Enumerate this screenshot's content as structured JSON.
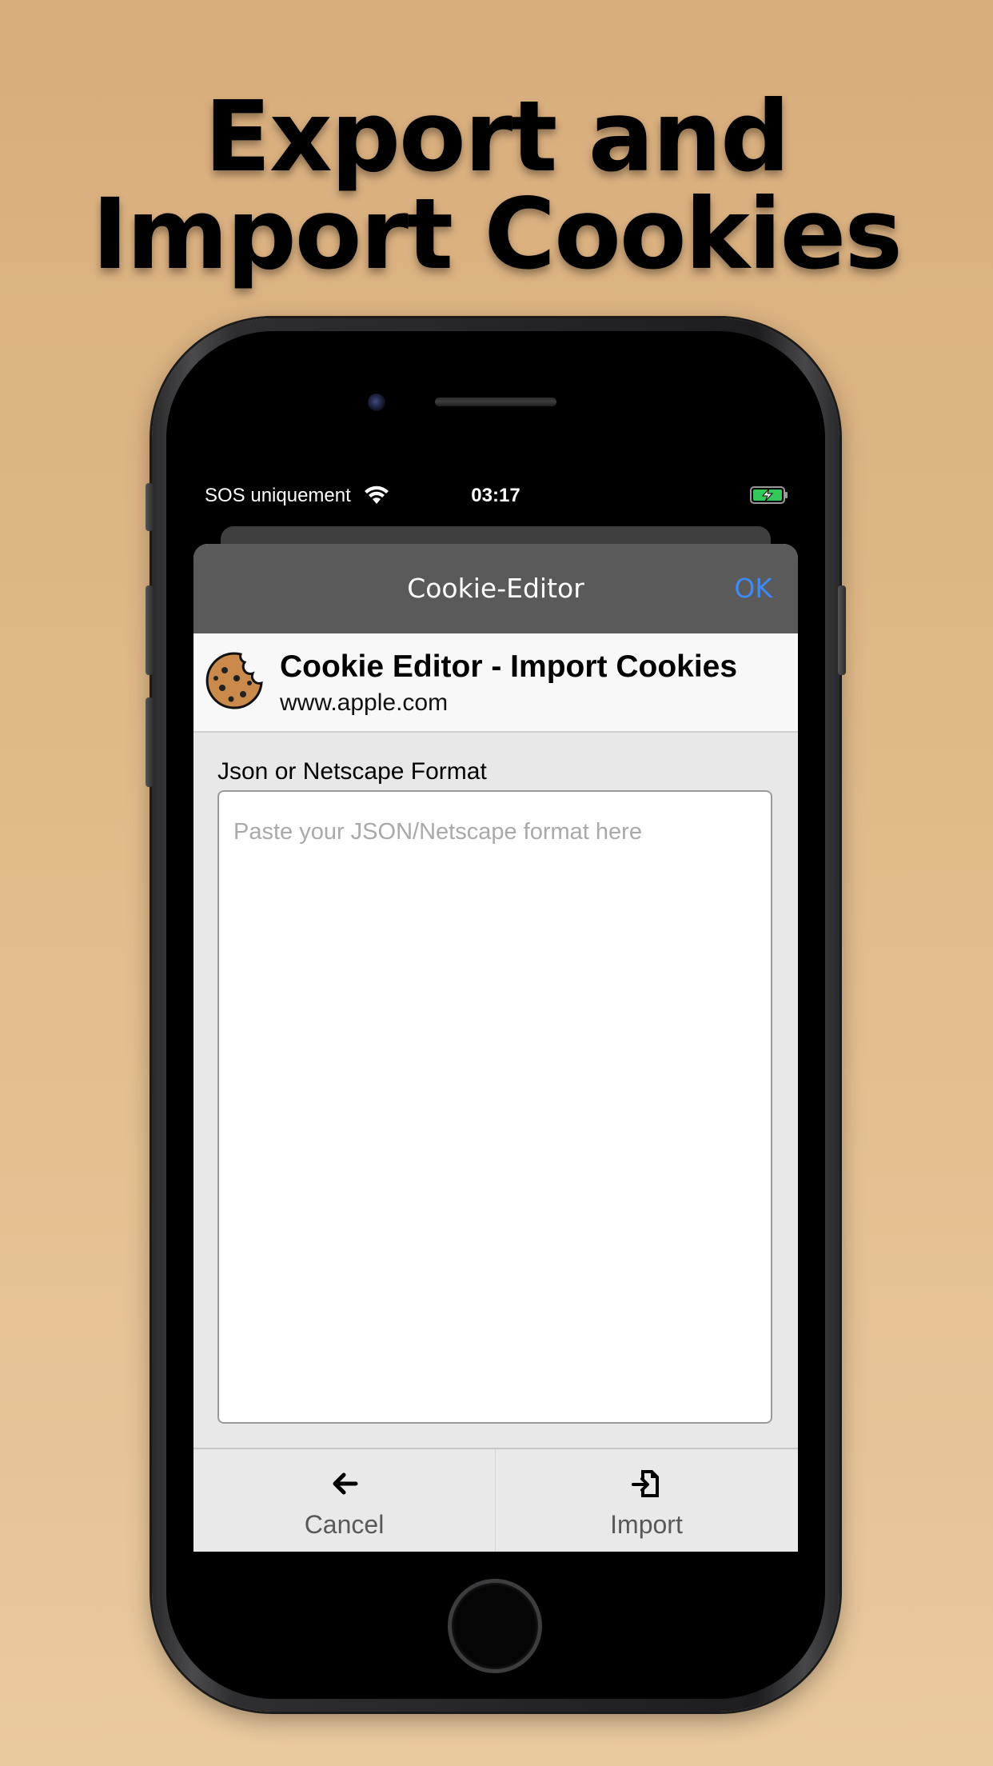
{
  "headline": {
    "line1": "Export and",
    "line2": "Import Cookies"
  },
  "status_bar": {
    "carrier": "SOS uniquement",
    "time": "03:17",
    "wifi_icon": "wifi-icon",
    "battery_icon": "battery-charging-icon"
  },
  "nav": {
    "title": "Cookie-Editor",
    "ok_label": "OK",
    "accent_color": "#3d8bf7"
  },
  "app_header": {
    "title": "Cookie Editor - Import Cookies",
    "domain": "www.apple.com",
    "icon": "cookie-icon"
  },
  "form": {
    "label": "Json or Netscape Format",
    "value": "",
    "placeholder": "Paste your JSON/Netscape format here"
  },
  "toolbar": {
    "cancel_label": "Cancel",
    "cancel_icon": "arrow-left-icon",
    "import_label": "Import",
    "import_icon": "file-import-icon"
  }
}
